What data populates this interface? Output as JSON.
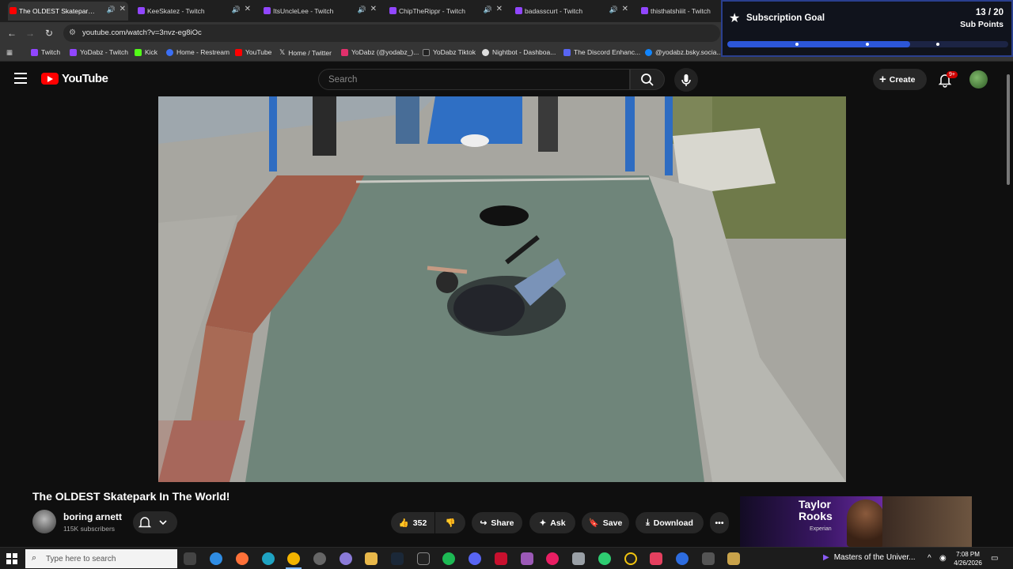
{
  "browser": {
    "tabs": [
      {
        "title": "The OLDEST Skatepark In The...",
        "active": true,
        "favicon_color": "#ff0000"
      },
      {
        "title": "KeeSkatez - Twitch",
        "active": false,
        "favicon_color": "#9146ff"
      },
      {
        "title": "ItsUncleLee - Twitch",
        "active": false,
        "favicon_color": "#9146ff"
      },
      {
        "title": "ChipTheRippr - Twitch",
        "active": false,
        "favicon_color": "#9146ff"
      },
      {
        "title": "badasscurt - Twitch",
        "active": false,
        "favicon_color": "#9146ff"
      },
      {
        "title": "thisthatshiiit - Twitch",
        "active": false,
        "favicon_color": "#9146ff"
      }
    ],
    "url": "youtube.com/watch?v=3nvz-eg8iOc",
    "bookmarks": [
      {
        "label": "Twitch",
        "color": "#9146ff"
      },
      {
        "label": "YoDabz - Twitch",
        "color": "#9146ff"
      },
      {
        "label": "Kick",
        "color": "#53fc18"
      },
      {
        "label": "Home - Restream",
        "color": "#3b6ff5"
      },
      {
        "label": "YouTube",
        "color": "#ff0000"
      },
      {
        "label": "Home / Twitter",
        "color": "#ffffff"
      },
      {
        "label": "YoDabz (@yodabz_)...",
        "color": "#e1306c"
      },
      {
        "label": "YoDabz Tiktok",
        "color": "#222222"
      },
      {
        "label": "Nightbot - Dashboa...",
        "color": "#dddddd"
      },
      {
        "label": "The Discord Enhanc...",
        "color": "#5865f2"
      },
      {
        "label": "@yodabz.bsky.socia...",
        "color": "#1185fe"
      }
    ]
  },
  "sub_goal": {
    "title": "Subscription Goal",
    "count": "13 / 20",
    "unit": "Sub Points",
    "progress": 0.65
  },
  "youtube": {
    "brand": "YouTube",
    "search_placeholder": "Search",
    "create_label": "Create",
    "notification_count": "9+",
    "video_title": "The OLDEST Skatepark In The World!",
    "channel_name": "boring arnett",
    "channel_subs": "115K subscribers",
    "likes": "352",
    "share_label": "Share",
    "ask_label": "Ask",
    "save_label": "Save",
    "download_label": "Download",
    "ad": {
      "line1": "Taylor",
      "line2": "Rooks",
      "brand": "Experian"
    }
  },
  "taskbar": {
    "search_placeholder": "Type here to search",
    "media_title": "Masters of the Univer...",
    "time": "7:08 PM",
    "date": "4/26/2026"
  },
  "colors": {
    "accent": "#2c56d8",
    "youtube_red": "#ff0000",
    "twitch_purple": "#9146ff"
  }
}
